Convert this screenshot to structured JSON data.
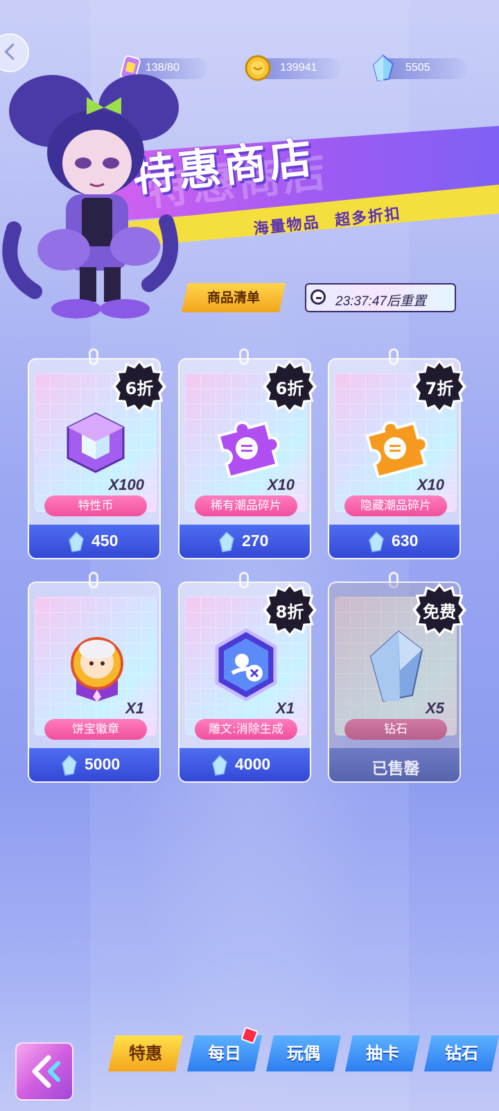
{
  "resources": {
    "stamina": "138/80",
    "coins": "139941",
    "diamonds": "5505"
  },
  "banner": {
    "title": "特惠商店",
    "subtitle_1": "海量物品",
    "subtitle_2": "超多折扣"
  },
  "shop": {
    "list_tab_label": "商品清单",
    "reset_timer": "23:37:47后重置",
    "items": [
      {
        "name": "特性币",
        "qty": "X100",
        "badge": "6折",
        "price": "450",
        "icon": "purple-cube-icon"
      },
      {
        "name": "稀有潮品碎片",
        "qty": "X10",
        "badge": "6折",
        "price": "270",
        "icon": "purple-puzzle-piece-icon"
      },
      {
        "name": "隐藏潮品碎片",
        "qty": "X10",
        "badge": "7折",
        "price": "630",
        "icon": "orange-puzzle-piece-icon"
      },
      {
        "name": "饼宝徽章",
        "qty": "X1",
        "badge": "",
        "price": "5000",
        "icon": "bingbao-badge-icon"
      },
      {
        "name": "雕文:消除生成",
        "qty": "X1",
        "badge": "8折",
        "price": "4000",
        "icon": "glyph-hexagon-icon"
      },
      {
        "name": "钻石",
        "qty": "X5",
        "badge": "免费",
        "price": "已售罄",
        "icon": "diamond-crystal-icon"
      }
    ]
  },
  "bottom_nav": {
    "tabs": [
      "特惠",
      "每日",
      "玩偶",
      "抽卡",
      "钻石"
    ],
    "active": "特惠"
  },
  "colors": {
    "accent_yellow": "#f4a51d",
    "tab_blue": "#2f7ef0",
    "name_pink": "#f14f9d",
    "price_blue": "#3448d6"
  }
}
